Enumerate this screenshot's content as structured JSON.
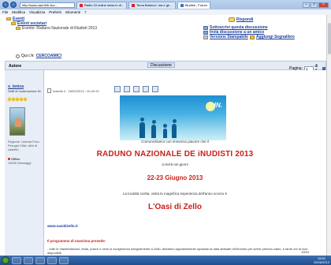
{
  "browser": {
    "address": "http://www.oasi.it/ib-ficc...",
    "tabs": [
      {
        "label": "Radio 24 online news in di..."
      },
      {
        "label": "Tema Barluco!, ma e ge..."
      },
      {
        "label": "iNudisti - Forum"
      }
    ],
    "menu": [
      "File",
      "Modifica",
      "Visualizza",
      "Preferiti",
      "Strumenti",
      "?"
    ],
    "zoom": "100%",
    "clock_time": "15:51",
    "clock_date": "25/06/2013"
  },
  "forum": {
    "tree": {
      "root": "Eventi",
      "sub": "Eventi societari",
      "topic": "Evento: Raduno Nazionale di iNudisti 2013"
    },
    "reply_label": "Rispondi",
    "actions": [
      "Sottoscrivi questa discussione",
      "Invia discussione a un amico",
      "Versione Stampabile",
      "Aggiungi Segnalibro"
    ],
    "qc_label": "Qui c'è:",
    "qc_link": "CERCOAMICI",
    "table_author": "Autore",
    "table_discussion": "Discussione",
    "page_label_top": "Pagina Successiva",
    "page_label": "Pagina:",
    "page_value": "1",
    "page_of": "di 4",
    "author": {
      "name": "o_lenica",
      "role": "Staff di moderazione Ni",
      "info": "Regione: Umbria Prov.: Perugia Città: città di castello",
      "status": "Offline",
      "messages": "15000 Messaggi"
    },
    "post": {
      "meta": "Inserito il - 16/02/2013 : 10:49:13",
      "banner_text": "IN.",
      "intro": "Comunichiamo con immenso piacere che il",
      "headline": "RADUNO NAZIONALE DE iNUDISTI 2013",
      "held": "si terrà nei giorni",
      "dates": "22-23 Giugno 2013",
      "location_intro": "La località scelta, visita la magnifica esperienza dell'anno scorso è",
      "location": "L'Oasi di Zello",
      "website": "www.oasidizello.it",
      "program_title": "Il programma di massima prevede:",
      "body": "- tutte le manifestazioni, festa, pranzi e cene si svolgeranno integralmente a Zello. Abbiamo appositamente spostato la data abituale dell'evento per avere periodo caldo, e tante ore di luce disponibili."
    }
  }
}
